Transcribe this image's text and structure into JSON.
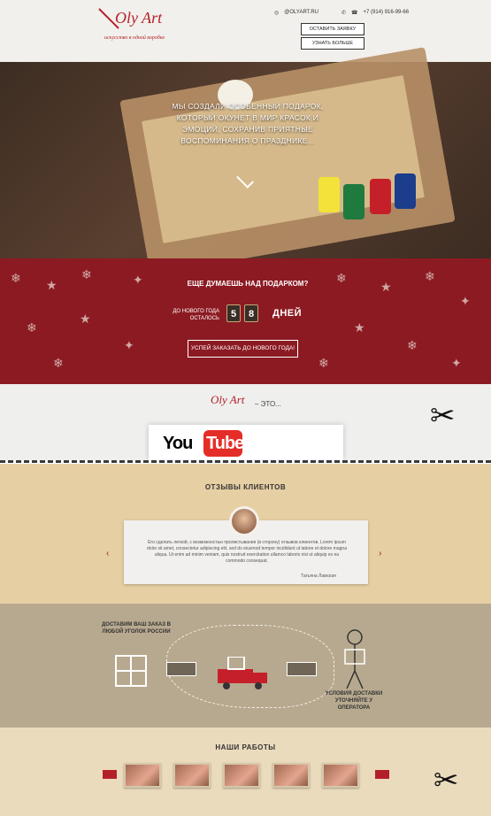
{
  "header": {
    "logo_text": "Oly Art",
    "logo_slogan": "искусство в одной коробке",
    "instagram": "@OLYART.RU",
    "phone": "+7 (914) 916-99-66",
    "btn_primary": "ОСТАВИТЬ ЗАЯВКУ",
    "btn_secondary": "УЗНАТЬ БОЛЬШЕ"
  },
  "hero": {
    "text": "МЫ СОЗДАЛИ ОСОБЕННЫЙ ПОДАРОК, КОТОРЫЙ ОКУНЕТ В МИР КРАСОК И ЭМОЦИЙ, СОХРАНИВ ПРИЯТНЫЕ ВОСПОМИНАНИЯ О ПРАЗДНИКЕ..."
  },
  "countdown": {
    "question": "ЕЩЕ ДУМАЕШЬ НАД ПОДАРКОМ?",
    "label": "ДО НОВОГО ГОДА ОСТАЛОСЬ",
    "digits": [
      "5",
      "8"
    ],
    "unit": "ДНЕЙ",
    "button": "УСПЕЙ ЗАКАЗАТЬ ДО НОВОГО ГОДА!"
  },
  "about": {
    "logo_text": "Oly Art",
    "suffix": "– ЭТО...",
    "video_brand_you": "You",
    "video_brand_tube": "Tube"
  },
  "reviews": {
    "title": "ОТЗЫВЫ КЛИЕНТОВ",
    "text": "Его сделать легкой, с возможностью пролистывания (в сторону) отзывов клиентов. Lorem ipsum dolor sit amet, consectetur adipiscing elit, sed do eiusmod tempor incididunt ut labore et dolore magna aliqua. Ut enim ad minim veniam, quis nostrud exercitation ullamco laboris nisi ut aliquip ex ea commodo consequat.",
    "author": "Татьяна Ламская"
  },
  "delivery": {
    "left_text": "ДОСТАВИМ ВАШ ЗАКАЗ В ЛЮБОЙ УГОЛОК РОССИИ",
    "right_text": "УСЛОВИЯ ДОСТАВКИ УТОЧНЯЙТЕ У ОПЕРАТОРА"
  },
  "works": {
    "title": "НАШИ РАБОТЫ",
    "thumbs": [
      "work-1",
      "work-2",
      "work-3",
      "work-4",
      "work-5"
    ]
  },
  "colors": {
    "accent": "#b3202a",
    "xmas_red": "#8c1a22",
    "reviews_bg": "#e7cfa4",
    "delivery_bg": "#b7a98f"
  }
}
